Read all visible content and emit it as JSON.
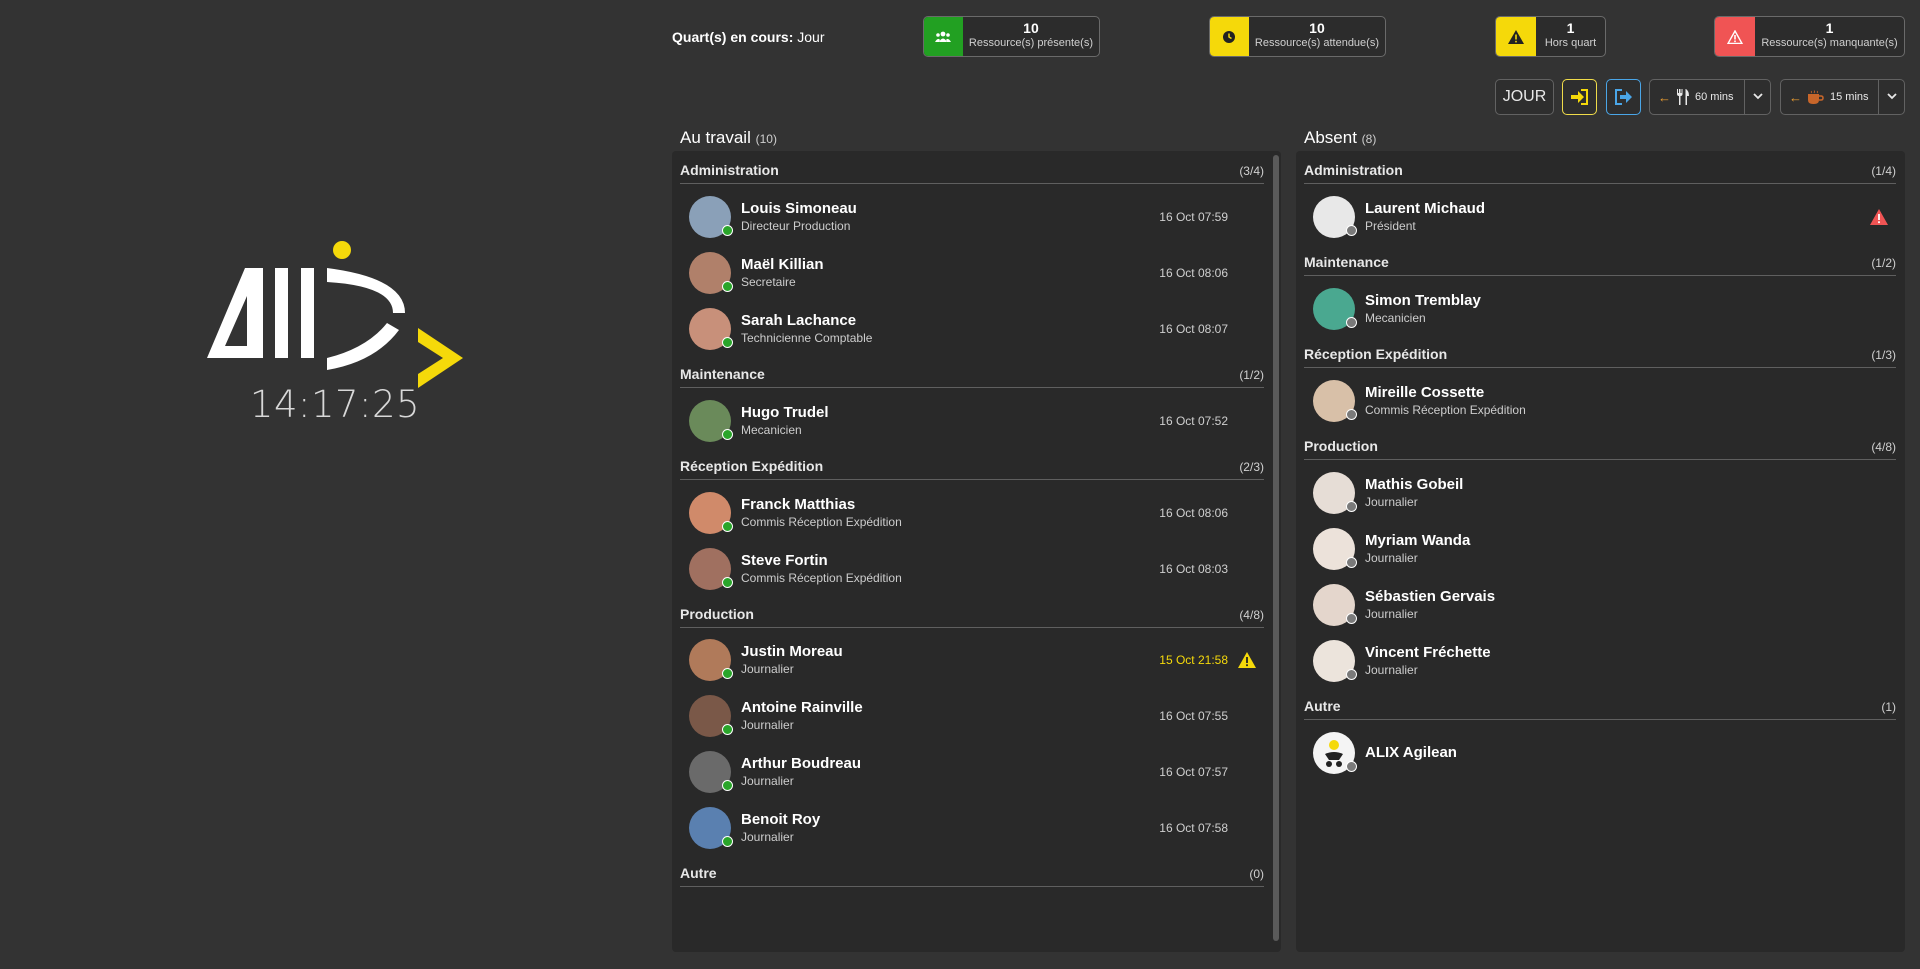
{
  "clock": "14:17:25",
  "shift": {
    "label": "Quart(s) en cours:",
    "value": "Jour"
  },
  "stats": [
    {
      "id": "present",
      "num": "10",
      "label": "Ressource(s) présente(s)",
      "color": "#22a022",
      "icon": "users-icon"
    },
    {
      "id": "expected",
      "num": "10",
      "label": "Ressource(s) attendue(s)",
      "color": "#f5d90a",
      "icon": "clock-icon"
    },
    {
      "id": "offshift",
      "num": "1",
      "label": "Hors quart",
      "color": "#f5d90a",
      "icon": "warning-icon"
    },
    {
      "id": "missing",
      "num": "1",
      "label": "Ressource(s) manquante(s)",
      "color": "#f05454",
      "icon": "warning-icon"
    }
  ],
  "toolbar": {
    "jour": "JOUR",
    "lunch": "60 mins",
    "coffee": "15 mins"
  },
  "at_work": {
    "title": "Au travail",
    "count": "(10)",
    "groups": [
      {
        "name": "Administration",
        "count": "(3/4)",
        "people": [
          {
            "name": "Louis Simoneau",
            "role": "Directeur Production",
            "time": "16 Oct 07:59"
          },
          {
            "name": "Maël Killian",
            "role": "Secretaire",
            "time": "16 Oct 08:06"
          },
          {
            "name": "Sarah Lachance",
            "role": "Technicienne Comptable",
            "time": "16 Oct 08:07"
          }
        ]
      },
      {
        "name": "Maintenance",
        "count": "(1/2)",
        "people": [
          {
            "name": "Hugo Trudel",
            "role": "Mecanicien",
            "time": "16 Oct 07:52"
          }
        ]
      },
      {
        "name": "Réception Expédition",
        "count": "(2/3)",
        "people": [
          {
            "name": "Franck Matthias",
            "role": "Commis Réception Expédition",
            "time": "16 Oct 08:06"
          },
          {
            "name": "Steve Fortin",
            "role": "Commis Réception Expédition",
            "time": "16 Oct 08:03"
          }
        ]
      },
      {
        "name": "Production",
        "count": "(4/8)",
        "people": [
          {
            "name": "Justin Moreau",
            "role": "Journalier",
            "time": "15 Oct 21:58"
          },
          {
            "name": "Antoine Rainville",
            "role": "Journalier",
            "time": "16 Oct 07:55"
          },
          {
            "name": "Arthur Boudreau",
            "role": "Journalier",
            "time": "16 Oct 07:57"
          },
          {
            "name": "Benoit Roy",
            "role": "Journalier",
            "time": "16 Oct 07:58"
          }
        ]
      },
      {
        "name": "Autre",
        "count": "(0)",
        "people": []
      }
    ]
  },
  "absent": {
    "title": "Absent",
    "count": "(8)",
    "groups": [
      {
        "name": "Administration",
        "count": "(1/4)",
        "people": [
          {
            "name": "Laurent Michaud",
            "role": "Président"
          }
        ]
      },
      {
        "name": "Maintenance",
        "count": "(1/2)",
        "people": [
          {
            "name": "Simon Tremblay",
            "role": "Mecanicien"
          }
        ]
      },
      {
        "name": "Réception Expédition",
        "count": "(1/3)",
        "people": [
          {
            "name": "Mireille Cossette",
            "role": "Commis Réception Expédition"
          }
        ]
      },
      {
        "name": "Production",
        "count": "(4/8)",
        "people": [
          {
            "name": "Mathis Gobeil",
            "role": "Journalier"
          },
          {
            "name": "Myriam Wanda",
            "role": "Journalier"
          },
          {
            "name": "Sébastien Gervais",
            "role": "Journalier"
          },
          {
            "name": "Vincent Fréchette",
            "role": "Journalier"
          }
        ]
      },
      {
        "name": "Autre",
        "count": "(1)",
        "people": [
          {
            "name": "ALIX Agilean",
            "role": ""
          }
        ]
      }
    ]
  }
}
